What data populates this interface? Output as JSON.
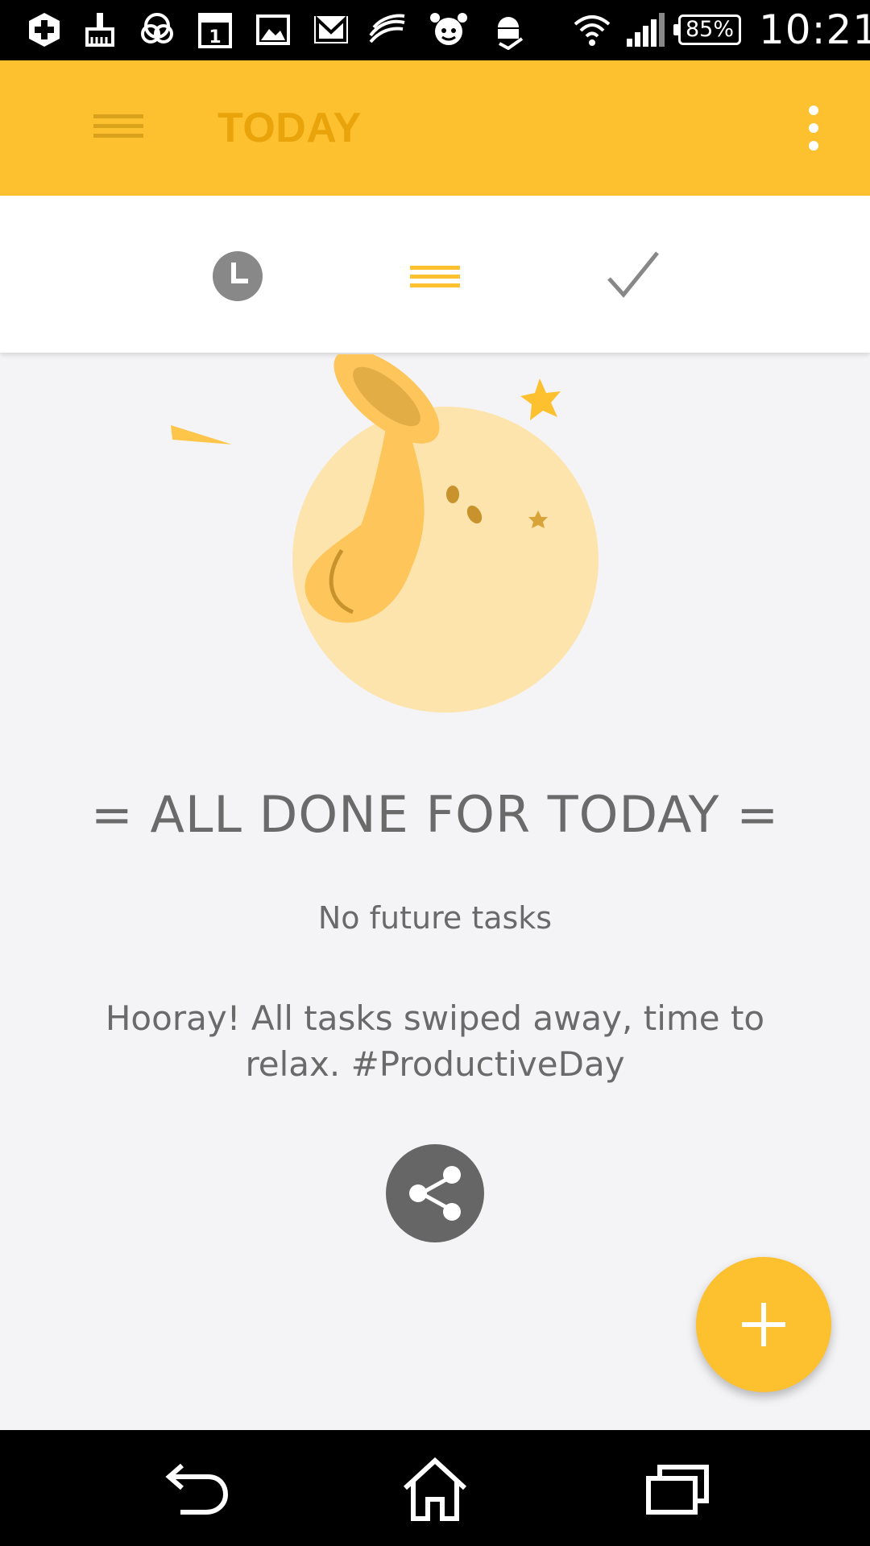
{
  "status_bar": {
    "battery_percent": "85%",
    "time": "10:21",
    "icons": [
      "add-icon",
      "cleaner-icon",
      "chat-icon",
      "calendar-icon",
      "gallery-icon",
      "gmail-icon",
      "sync-icon",
      "alarm-icon",
      "android-download-icon",
      "wifi-icon",
      "signal-icon",
      "battery-icon"
    ],
    "calendar_day": "1"
  },
  "app_bar": {
    "title": "TODAY",
    "menu_icon": "hamburger-icon",
    "more_icon": "overflow-menu-icon"
  },
  "tabs": [
    {
      "name": "later",
      "icon": "clock-icon",
      "active": false
    },
    {
      "name": "today",
      "icon": "list-icon",
      "active": true
    },
    {
      "name": "done",
      "icon": "check-icon",
      "active": false
    }
  ],
  "empty_state": {
    "headline": "= ALL DONE FOR TODAY =",
    "subtext": "No future tasks",
    "message": "Hooray! All tasks swiped away, time to relax. #ProductiveDay",
    "share_icon": "share-icon"
  },
  "fab": {
    "icon": "plus-icon"
  },
  "nav_bar": {
    "icons": [
      "back-icon",
      "home-icon",
      "recents-icon"
    ]
  },
  "colors": {
    "accent": "#fdc02f",
    "title": "#e8a40a",
    "text": "#6a6a6a",
    "background": "#f4f4f6"
  }
}
